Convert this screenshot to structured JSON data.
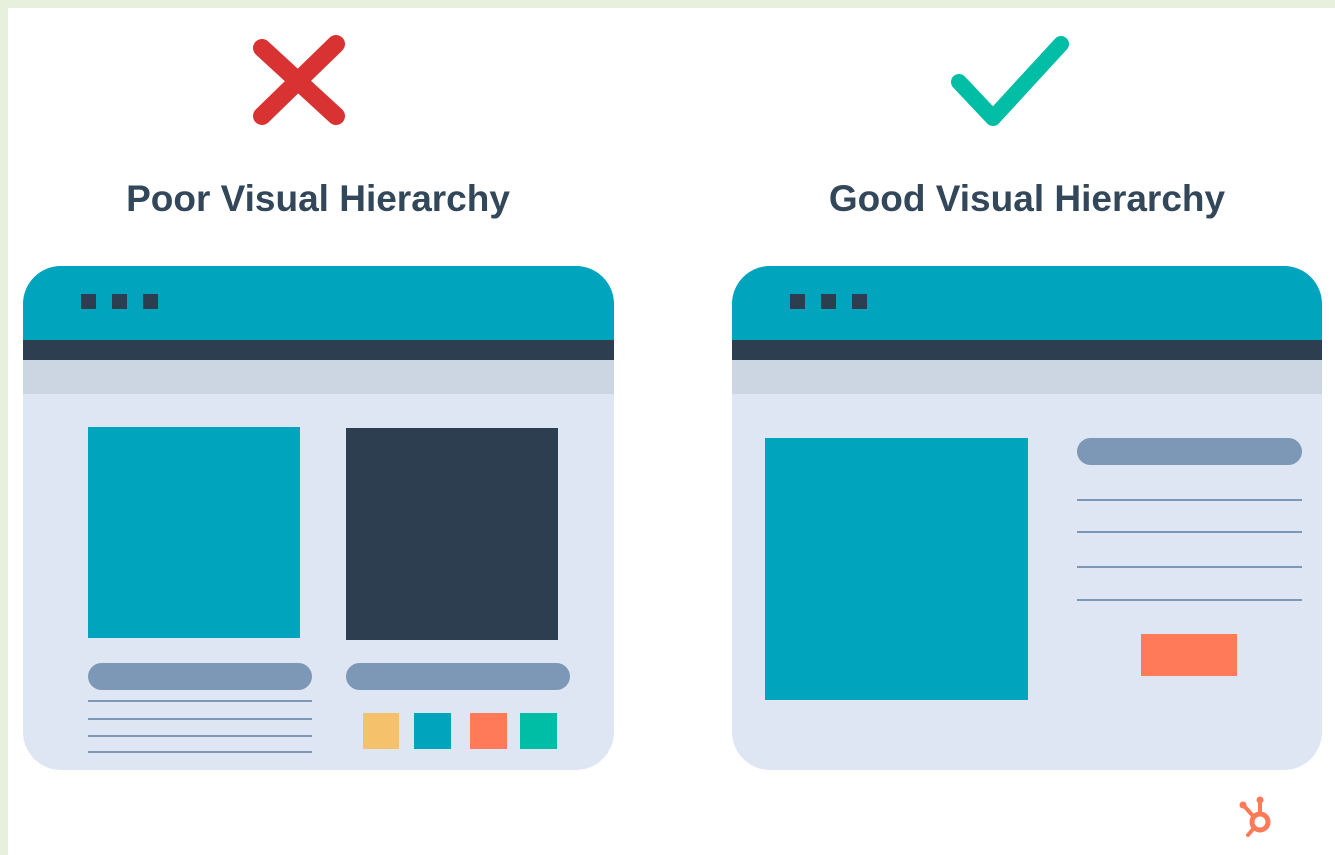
{
  "left": {
    "title": "Poor Visual Hierarchy",
    "icon": "x-mark-icon",
    "icon_color": "#d93232"
  },
  "right": {
    "title": "Good Visual Hierarchy",
    "icon": "check-mark-icon",
    "icon_color": "#00bda5"
  },
  "colors": {
    "teal": "#00a4bd",
    "dark": "#2d3e50",
    "window_body": "#dfe6f3",
    "slate": "#7c98b6",
    "yellow": "#f5c26b",
    "orange": "#ff7a59",
    "green": "#00bda5"
  },
  "brand": {
    "logo": "hubspot-sprocket-icon",
    "color": "#ff7a59"
  }
}
